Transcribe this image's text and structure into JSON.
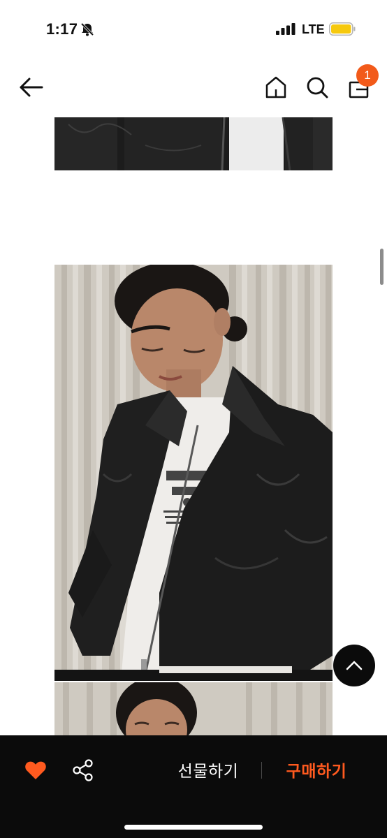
{
  "status_bar": {
    "time": "1:17",
    "network": "LTE",
    "battery_color": "#f6c90e"
  },
  "nav": {
    "back_icon": "arrow-left-icon",
    "home_icon": "home-icon",
    "search_icon": "search-icon",
    "bag_icon": "shopping-bag-icon",
    "cart_count": "1",
    "badge_color": "#f25a1a"
  },
  "content": {
    "images": [
      "black-leather-jacket-detail",
      "model-in-black-leather-jacket",
      "model-portrait"
    ]
  },
  "bottom_bar": {
    "wishlist_icon": "heart-icon",
    "wishlist_color": "#ff5a1f",
    "share_icon": "share-icon",
    "gift_label": "선물하기",
    "buy_label": "구매하기",
    "buy_color": "#ff5a1f"
  }
}
